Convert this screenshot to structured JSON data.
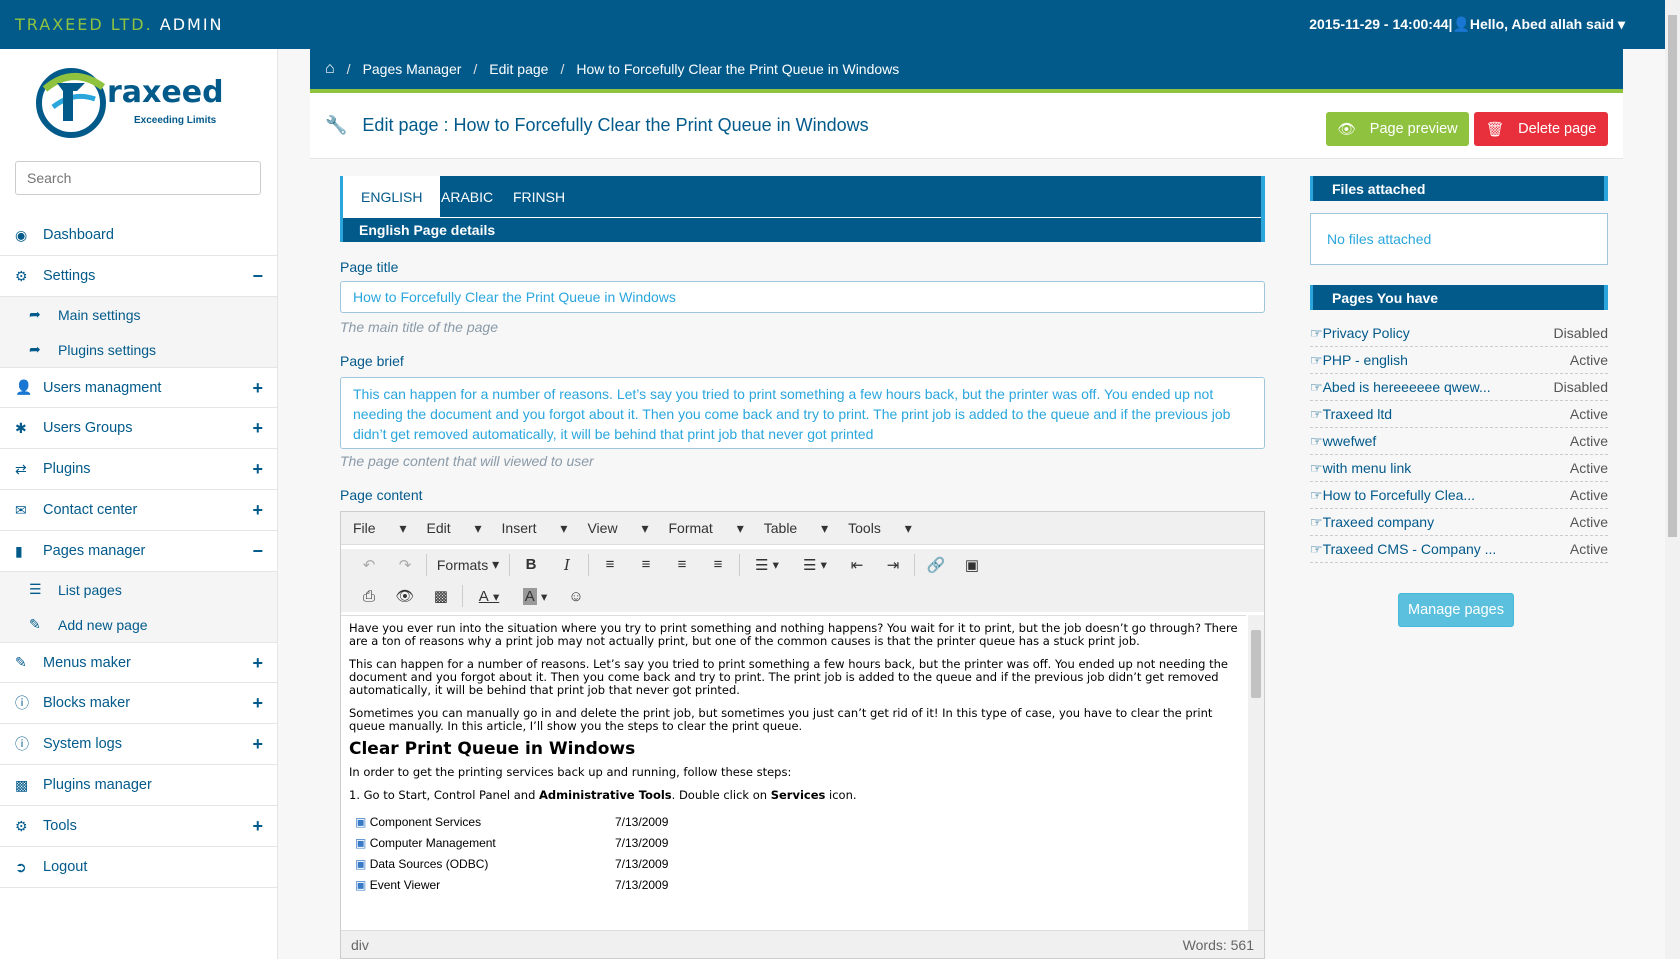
{
  "topbar": {
    "brand_part1": "TRAXEED LTD.",
    "brand_part2": "ADMIN",
    "datetime": "2015-11-29 - 14:00:44",
    "greeting": "Hello, Abed allah said"
  },
  "sidebar": {
    "logo_text": "raxeed",
    "logo_tagline": "Exceeding Limits",
    "search_placeholder": "Search",
    "items": [
      {
        "label": "Dashboard",
        "icon": "dashboard-icon",
        "toggle": ""
      },
      {
        "label": "Settings",
        "icon": "gear-icon",
        "toggle": "−"
      },
      {
        "label": "Main settings",
        "icon": "share-icon"
      },
      {
        "label": "Plugins settings",
        "icon": "share-icon"
      },
      {
        "label": "Users managment",
        "icon": "user-icon",
        "toggle": "+"
      },
      {
        "label": "Users Groups",
        "icon": "asterisk-icon",
        "toggle": "+"
      },
      {
        "label": "Plugins",
        "icon": "retweet-icon",
        "toggle": "+"
      },
      {
        "label": "Contact center",
        "icon": "envelope-icon",
        "toggle": "+"
      },
      {
        "label": "Pages manager",
        "icon": "file-icon",
        "toggle": "−"
      },
      {
        "label": "List pages",
        "icon": "list-icon"
      },
      {
        "label": "Add new page",
        "icon": "pencil-icon"
      },
      {
        "label": "Menus maker",
        "icon": "pencil-icon",
        "toggle": "+"
      },
      {
        "label": "Blocks maker",
        "icon": "info-icon",
        "toggle": "+"
      },
      {
        "label": "System logs",
        "icon": "info-icon",
        "toggle": "+"
      },
      {
        "label": "Plugins manager",
        "icon": "bar-chart-icon",
        "toggle": ""
      },
      {
        "label": "Tools",
        "icon": "gear-icon",
        "toggle": "+"
      },
      {
        "label": "Logout",
        "icon": "logout-icon",
        "toggle": ""
      }
    ]
  },
  "breadcrumb": [
    "Pages Manager",
    "Edit page",
    "How to Forcefully Clear the Print Queue in Windows"
  ],
  "page_header": {
    "title": "Edit page : How to Forcefully Clear the Print Queue in Windows",
    "preview_label": "Page preview",
    "delete_label": "Delete page"
  },
  "tabs": [
    "ENGLISH",
    "ARABIC",
    "FRINSH"
  ],
  "tab_subtitle": "English Page details",
  "form": {
    "title_label": "Page title",
    "title_value": "How to Forcefully Clear the Print Queue in Windows",
    "title_help": "The main title of the page",
    "brief_label": "Page brief",
    "brief_value": "This can happen for a number of reasons. Let’s say you tried to print something a few hours back, but the printer was off. You ended up not needing the document and you forgot about it. Then you come back and try to print. The print job is added to the queue and if the previous job didn’t get removed automatically, it will be behind that print job that never got printed",
    "brief_help": "The page content that will viewed to user",
    "content_label": "Page content"
  },
  "editor": {
    "menus": [
      "File",
      "Edit",
      "Insert",
      "View",
      "Format",
      "Table",
      "Tools"
    ],
    "formats_label": "Formats",
    "p1": " Have you ever run into the situation where you try to print something and nothing happens? You wait for it to print, but the job doesn’t go through? There are a ton of reasons why a print job may not actually print, but one of the common causes is that the printer queue has a stuck print job.",
    "p2": "This can happen for a number of reasons. Let’s say you tried to print something a few hours back, but the printer was off. You ended up not needing the document and you forgot about it. Then you come back and try to print. The print job is added to the queue and if the previous job didn’t get removed automatically, it will be behind that print job that never got printed.",
    "p3": "Sometimes you can manually go in and delete the print job, but sometimes you just can’t get rid of it! In this type of case, you have to clear the print queue manually. In this article, I’ll show you the steps to clear the print queue.",
    "h2": "Clear Print Queue in Windows",
    "p4": "In order to get the printing services back up and running, follow these steps:",
    "step1_pre": "1. Go to Start, Control Panel and ",
    "step1_b1": "Administrative Tools",
    "step1_mid": ". Double click on ",
    "step1_b2": "Services",
    "step1_post": " icon.",
    "files": [
      {
        "name": "Component Services",
        "date": "7/13/2009"
      },
      {
        "name": "Computer Management",
        "date": "7/13/2009"
      },
      {
        "name": "Data Sources (ODBC)",
        "date": "7/13/2009"
      },
      {
        "name": "Event Viewer",
        "date": "7/13/2009"
      }
    ],
    "status_path": "div",
    "word_count": "Words: 561"
  },
  "files_panel": {
    "title": "Files attached",
    "empty": "No files attached"
  },
  "pages_panel": {
    "title": "Pages You have",
    "pages": [
      {
        "name": "Privacy Policy",
        "status": "Disabled"
      },
      {
        "name": "PHP - english",
        "status": "Active"
      },
      {
        "name": "Abed is hereeeeee qwew...",
        "status": "Disabled"
      },
      {
        "name": "Traxeed ltd",
        "status": "Active"
      },
      {
        "name": "wwefwef",
        "status": "Active"
      },
      {
        "name": "with menu link",
        "status": "Active"
      },
      {
        "name": "How to Forcefully Clea...",
        "status": "Active"
      },
      {
        "name": "Traxeed company",
        "status": "Active"
      },
      {
        "name": "Traxeed CMS - Company ...",
        "status": "Active"
      }
    ],
    "manage_label": "Manage pages"
  },
  "colors": {
    "primary": "#025a8b",
    "accent": "#8fc33f",
    "danger": "#e8303c",
    "info": "#5bc0de"
  }
}
